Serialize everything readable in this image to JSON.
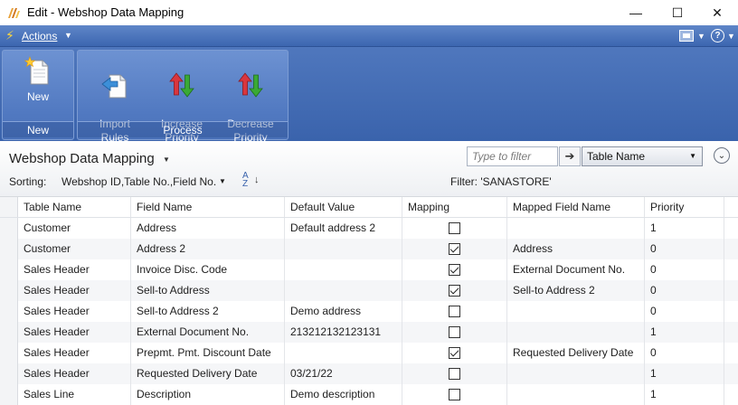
{
  "window": {
    "title": "Edit - Webshop Data Mapping",
    "minimize": "—",
    "maximize": "☐",
    "close": "✕"
  },
  "actionsbar": {
    "label": "Actions"
  },
  "ribbon": {
    "groups": [
      {
        "caption": "New",
        "buttons": [
          {
            "label": "New"
          }
        ]
      },
      {
        "caption": "Process",
        "buttons": [
          {
            "label": "Import\nRules"
          },
          {
            "label": "Increase\nPriority"
          },
          {
            "label": "Decrease\nPriority"
          }
        ]
      }
    ]
  },
  "page": {
    "title": "Webshop Data Mapping",
    "filter_placeholder": "Type to filter",
    "filter_field": "Table Name",
    "sorting_label": "Sorting:",
    "sorting_value": "Webshop ID,Table No.,Field No.",
    "filter_text": "Filter: 'SANASTORE'"
  },
  "grid": {
    "columns": [
      "Table Name",
      "Field Name",
      "Default Value",
      "Mapping",
      "Mapped Field Name",
      "Priority"
    ],
    "rows": [
      {
        "table": "Customer",
        "field": "Address",
        "default": "Default address 2",
        "mapping": false,
        "mapped": "",
        "priority": "1"
      },
      {
        "table": "Customer",
        "field": "Address 2",
        "default": "",
        "mapping": true,
        "mapped": "Address",
        "priority": "0"
      },
      {
        "table": "Sales Header",
        "field": "Invoice Disc. Code",
        "default": "",
        "mapping": true,
        "mapped": "External Document No.",
        "priority": "0"
      },
      {
        "table": "Sales Header",
        "field": "Sell-to Address",
        "default": "",
        "mapping": true,
        "mapped": "Sell-to Address 2",
        "priority": "0"
      },
      {
        "table": "Sales Header",
        "field": "Sell-to Address 2",
        "default": "Demo address",
        "mapping": false,
        "mapped": "",
        "priority": "0"
      },
      {
        "table": "Sales Header",
        "field": "External Document No.",
        "default": "213212132123131",
        "mapping": false,
        "mapped": "",
        "priority": "1"
      },
      {
        "table": "Sales Header",
        "field": "Prepmt. Pmt. Discount Date",
        "default": "",
        "mapping": true,
        "mapped": "Requested Delivery Date",
        "priority": "0"
      },
      {
        "table": "Sales Header",
        "field": "Requested Delivery Date",
        "default": "03/21/22",
        "mapping": false,
        "mapped": "",
        "priority": "1"
      },
      {
        "table": "Sales Line",
        "field": "Description",
        "default": "Demo description",
        "mapping": false,
        "mapped": "",
        "priority": "1"
      }
    ]
  },
  "colors": {
    "ribbon_blue": "#4a71b8",
    "increase_arrow_red": "#d9363e",
    "increase_arrow_green": "#3aa935"
  }
}
